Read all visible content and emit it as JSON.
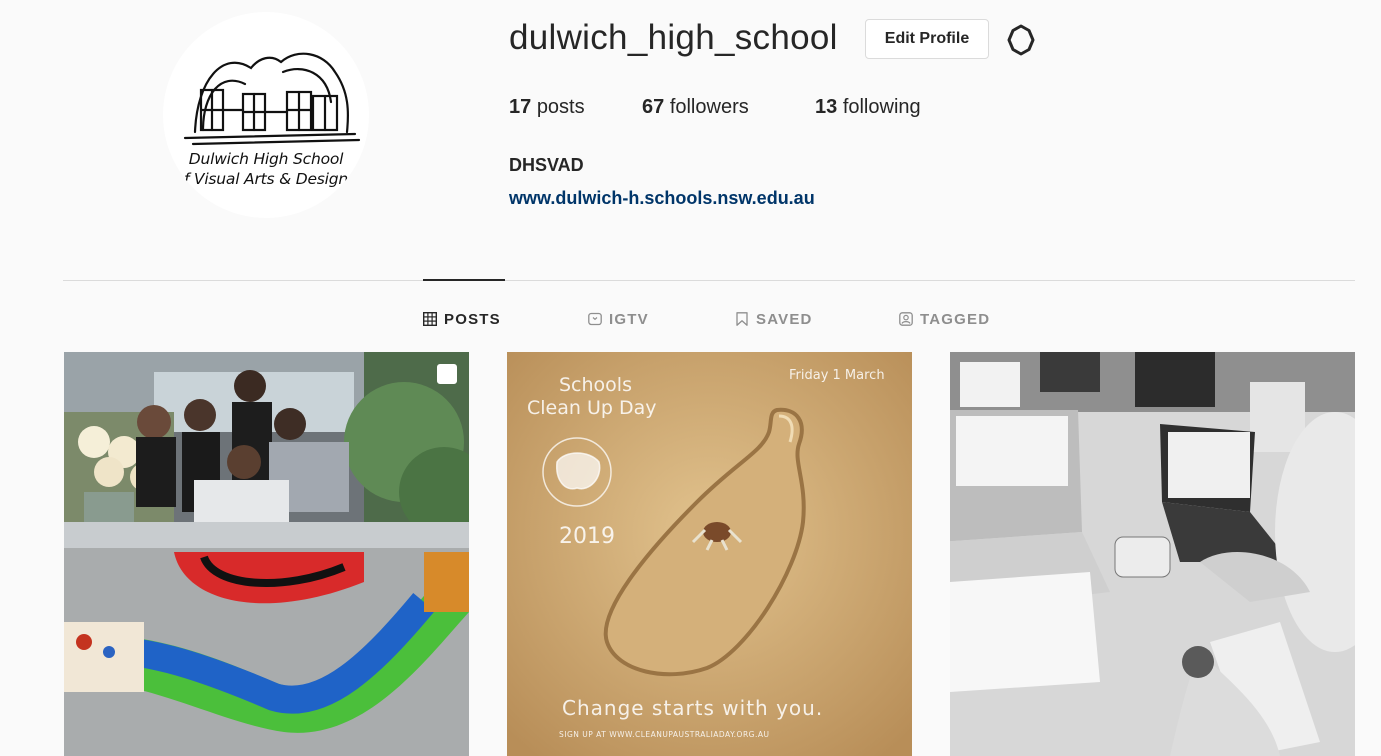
{
  "profile": {
    "username": "dulwich_high_school",
    "edit_label": "Edit Profile",
    "posts_count": "17",
    "posts_label": "posts",
    "followers_count": "67",
    "followers_label": "followers",
    "following_count": "13",
    "following_label": "following",
    "full_name": "DHSVAD",
    "website": "www.dulwich-h.schools.nsw.edu.au",
    "avatar_text": [
      "Dulwich High School",
      "f Visual Arts & Design"
    ]
  },
  "tabs": [
    {
      "label": "POSTS",
      "icon": "grid-icon",
      "active": true
    },
    {
      "label": "IGTV",
      "icon": "tv-icon",
      "active": false
    },
    {
      "label": "SAVED",
      "icon": "bookmark-icon",
      "active": false
    },
    {
      "label": "TAGGED",
      "icon": "tag-person-icon",
      "active": false
    }
  ],
  "posts": [
    {
      "kind": "photo",
      "multi": true,
      "icon": "carousel-icon"
    },
    {
      "kind": "poster",
      "title_line1": "Schools",
      "title_line2": "Clean Up Day",
      "year": "2019",
      "date": "Friday 1 March",
      "tagline": "Change starts with you.",
      "footer": "SIGN UP AT WWW.CLEANUPAUSTRALIADAY.ORG.AU"
    },
    {
      "kind": "photo-bw"
    }
  ],
  "colors": {
    "background": "#fafafa",
    "text": "#262626",
    "muted": "#8e8e8e",
    "link": "#003569",
    "border": "#dbdbdb"
  }
}
